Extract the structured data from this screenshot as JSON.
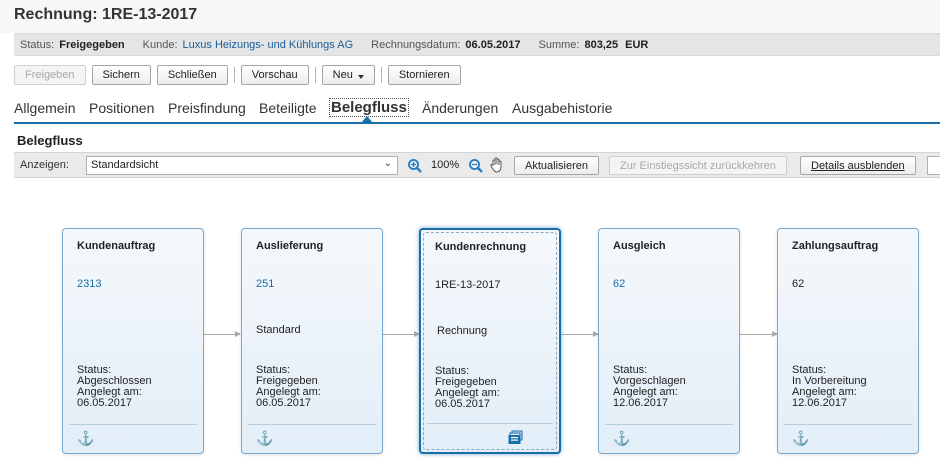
{
  "title": "Rechnung: 1RE-13-2017",
  "header": {
    "status_label": "Status:",
    "status_value": "Freigegeben",
    "kunde_label": "Kunde:",
    "kunde_value": "Luxus Heizungs- und Kühlungs AG",
    "datum_label": "Rechnungsdatum:",
    "datum_value": "06.05.2017",
    "summe_label": "Summe:",
    "summe_value": "803,25",
    "waehrung": "EUR"
  },
  "toolbar": {
    "freigeben": "Freigeben",
    "sichern": "Sichern",
    "schliessen": "Schließen",
    "vorschau": "Vorschau",
    "neu": "Neu",
    "stornieren": "Stornieren"
  },
  "tabs": [
    "Allgemein",
    "Positionen",
    "Preisfindung",
    "Beteiligte",
    "Belegfluss",
    "Änderungen",
    "Ausgabehistorie"
  ],
  "active_tab": "Belegfluss",
  "section_title": "Belegfluss",
  "view_bar": {
    "anzeigen_label": "Anzeigen:",
    "select_value": "Standardsicht",
    "zoom": "100%",
    "aktualisieren": "Aktualisieren",
    "einstieg": "Zur Einstiegssicht zurückkehren",
    "details": "Details ausblenden"
  },
  "nodes": [
    {
      "title": "Kundenauftrag",
      "number": "2313",
      "link": true,
      "desc": "",
      "status_label": "Status:",
      "status": "Abgeschlossen",
      "created_label": "Angelegt am:",
      "created": "06.05.2017",
      "icon": "anchor-icon"
    },
    {
      "title": "Auslieferung",
      "number": "251",
      "link": true,
      "desc": "Standard",
      "status_label": "Status:",
      "status": "Freigegeben",
      "created_label": "Angelegt am:",
      "created": "06.05.2017",
      "icon": "anchor-icon"
    },
    {
      "title": "Kundenrechnung",
      "number": "1RE-13-2017",
      "link": false,
      "desc": "Rechnung",
      "status_label": "Status:",
      "status": "Freigegeben",
      "created_label": "Angelegt am:",
      "created": "06.05.2017",
      "icon": "document-stack-icon"
    },
    {
      "title": "Ausgleich",
      "number": "62",
      "link": true,
      "desc": "",
      "status_label": "Status:",
      "status": "Vorgeschlagen",
      "created_label": "Angelegt am:",
      "created": "12.06.2017",
      "icon": "anchor-icon"
    },
    {
      "title": "Zahlungsauftrag",
      "number": "62",
      "link": false,
      "desc": "",
      "status_label": "Status:",
      "status": "In Vorbereitung",
      "created_label": "Angelegt am:",
      "created": "12.06.2017",
      "icon": "anchor-icon"
    }
  ],
  "colors": {
    "accent": "#1a6ea8",
    "link": "#1a5c96",
    "node_border": "#79a9d0"
  }
}
